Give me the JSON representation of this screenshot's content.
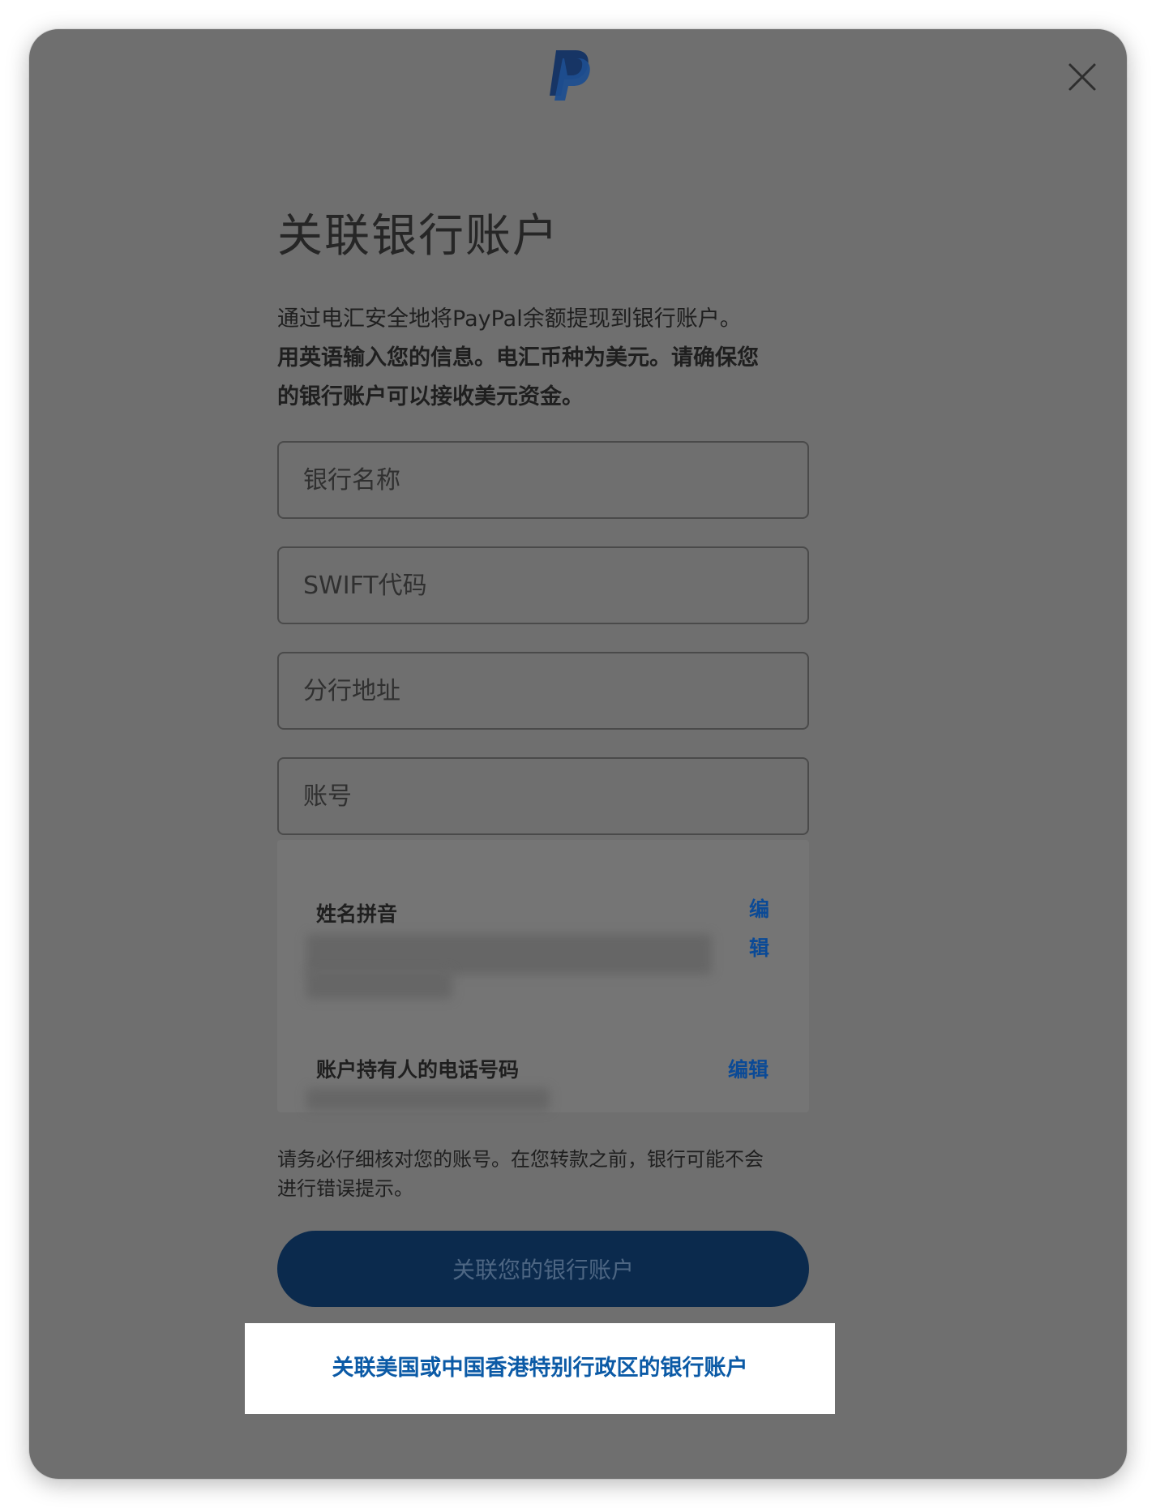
{
  "modal": {
    "logo_icon": "paypal-logo-icon",
    "close_icon": "close-icon",
    "colors": {
      "overlay": "#6f6f6f",
      "logo_dark": "#173565",
      "logo_light": "#1d4e8f",
      "button": "#0b2a4d",
      "link": "#0b5aa6"
    }
  },
  "title": "关联银行账户",
  "intro": {
    "line1": "通过电汇安全地将PayPal余额提现到银行账户。",
    "line2": "用英语输入您的信息。电汇币种为美元。请确保您",
    "line3": "的银行账户可以接收美元资金。"
  },
  "form": {
    "bank_name_placeholder": "银行名称",
    "swift_placeholder": "SWIFT代码",
    "branch_address_placeholder": "分行地址",
    "account_number_placeholder": "账号"
  },
  "info": {
    "name_label": "姓名拼音",
    "name_edit_line1": "编",
    "name_edit_line2": "辑",
    "phone_label": "账户持有人的电话号码",
    "phone_edit": "编辑"
  },
  "warning": {
    "line1": "请务必仔细核对您的账号。在您转款之前，银行可能不会",
    "line2": "进行错误提示。"
  },
  "submit_label": "关联您的银行账户",
  "alt_link_label": "关联美国或中国香港特别行政区的银行账户"
}
